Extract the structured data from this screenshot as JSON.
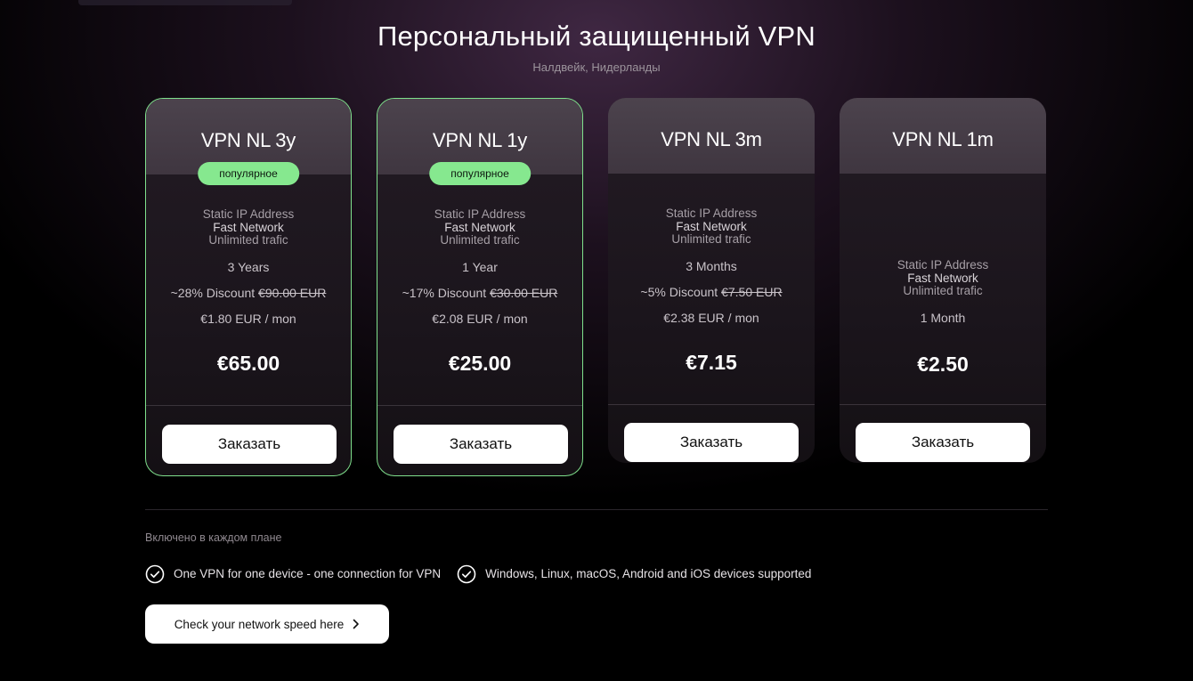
{
  "header": {
    "title": "Персональный защищенный VPN",
    "subtitle": "Налдвейк, Нидерланды"
  },
  "plans": [
    {
      "name": "VPN NL 3y",
      "badge": "популярное",
      "features": [
        "Static IP Address",
        "Fast Network",
        "Unlimited trafic"
      ],
      "period": "3 Years",
      "discount_text": "~28% Discount",
      "old_price": "€90.00 EUR",
      "per_month": "€1.80 EUR / mon",
      "price": "€65.00",
      "order_label": "Заказать"
    },
    {
      "name": "VPN NL 1y",
      "badge": "популярное",
      "features": [
        "Static IP Address",
        "Fast Network",
        "Unlimited trafic"
      ],
      "period": "1 Year",
      "discount_text": "~17% Discount",
      "old_price": "€30.00 EUR",
      "per_month": "€2.08 EUR / mon",
      "price": "€25.00",
      "order_label": "Заказать"
    },
    {
      "name": "VPN NL 3m",
      "features": [
        "Static IP Address",
        "Fast Network",
        "Unlimited trafic"
      ],
      "period": "3 Months",
      "discount_text": "~5% Discount",
      "old_price": "€7.50 EUR",
      "per_month": "€2.38 EUR / mon",
      "price": "€7.15",
      "order_label": "Заказать"
    },
    {
      "name": "VPN NL 1m",
      "features": [
        "Static IP Address",
        "Fast Network",
        "Unlimited trafic"
      ],
      "period": "1 Month",
      "price": "€2.50",
      "order_label": "Заказать"
    }
  ],
  "included": {
    "label": "Включено в каждом плане",
    "items": [
      "One VPN for one device - one connection for VPN",
      "Windows, Linux, macOS, Android and iOS devices supported"
    ]
  },
  "speed_button": {
    "label": "Check your network speed here"
  },
  "colors": {
    "accent_green": "#86e88f",
    "card_border_popular": "#7fe08c",
    "background": "#000000"
  },
  "icons": {
    "check": "check-circle-icon",
    "chevron": "chevron-right-icon"
  }
}
